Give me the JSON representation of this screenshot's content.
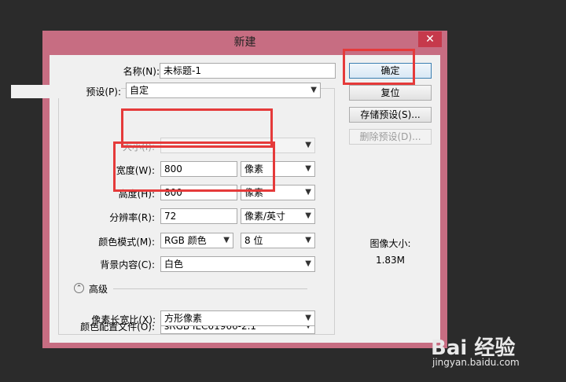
{
  "dialog": {
    "title": "新建",
    "close": "✕"
  },
  "fields": {
    "name_label": "名称(N):",
    "name_value": "未标题-1",
    "preset_label": "预设(P):",
    "preset_value": "自定",
    "size_label": "大小(I):",
    "width_label": "宽度(W):",
    "width_value": "800",
    "width_unit": "像素",
    "height_label": "高度(H):",
    "height_value": "800",
    "height_unit": "像素",
    "resolution_label": "分辨率(R):",
    "resolution_value": "72",
    "resolution_unit": "像素/英寸",
    "color_mode_label": "颜色模式(M):",
    "color_mode_value": "RGB 颜色",
    "bit_depth_value": "8 位",
    "background_label": "背景内容(C):",
    "background_value": "白色",
    "advanced_label": "高级",
    "color_profile_label": "颜色配置文件(O):",
    "color_profile_value": "sRGB IEC61966-2.1",
    "pixel_aspect_label": "像素长宽比(X):",
    "pixel_aspect_value": "方形像素"
  },
  "buttons": {
    "ok": "确定",
    "reset": "复位",
    "save_preset": "存储预设(S)...",
    "delete_preset": "删除预设(D)..."
  },
  "image_size": {
    "label": "图像大小:",
    "value": "1.83M"
  },
  "watermark": {
    "logo": "Bai 经验",
    "url": "jingyan.baidu.com"
  },
  "colors": {
    "annotation_red": "#e53a3a",
    "window_frame": "#c76d82"
  }
}
